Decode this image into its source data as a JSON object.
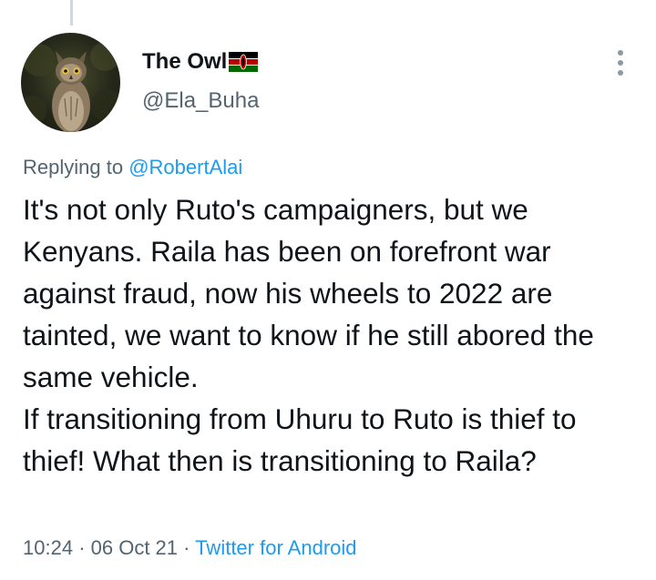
{
  "tweet": {
    "author": {
      "display_name": "The Owl",
      "handle": "@Ela_Buha",
      "avatar_icon": "owl-avatar",
      "flag_icon": "kenya-flag-icon"
    },
    "menu_icon": "more-vertical-icon",
    "replying_prefix": "Replying to",
    "replying_to": "@RobertAlai",
    "text": "It's not only Ruto's campaigners, but we Kenyans. Raila has been on forefront war against fraud, now his wheels to 2022 are tainted, we want to know if he still abored the same vehicle.\nIf transitioning from Uhuru to Ruto is thief to thief! What then is transitioning to Raila?",
    "time": "10:24",
    "separator": "·",
    "date": "06 Oct 21",
    "source": "Twitter for Android"
  },
  "colors": {
    "text": "#0f1419",
    "secondary": "#536471",
    "link": "#1d9bf0",
    "thread_line": "#cfd9de"
  }
}
